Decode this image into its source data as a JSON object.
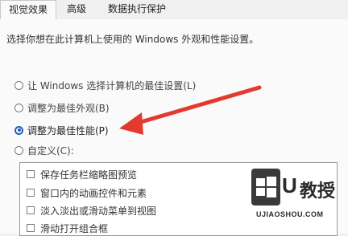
{
  "tabs": [
    {
      "label": "视觉效果",
      "active": true
    },
    {
      "label": "高级",
      "active": false
    },
    {
      "label": "数据执行保护",
      "active": false
    }
  ],
  "intro_text": "选择你想在此计算机上使用的 Windows 外观和性能设置。",
  "radio_options": [
    {
      "label": "让 Windows 选择计算机的最佳设置(L)",
      "checked": false
    },
    {
      "label": "调整为最佳外观(B)",
      "checked": false
    },
    {
      "label": "调整为最佳性能(P)",
      "checked": true
    },
    {
      "label": "自定义(C):",
      "checked": false
    }
  ],
  "checkbox_items": [
    {
      "label": "保存任务栏缩略图预览",
      "checked": false
    },
    {
      "label": "窗口内的动画控件和元素",
      "checked": false
    },
    {
      "label": "淡入淡出或滑动菜单到视图",
      "checked": false
    },
    {
      "label": "滑动打开组合框",
      "checked": false
    }
  ],
  "annotation": {
    "arrow_color": "#e23a2e"
  },
  "watermark": {
    "brand_letter": "U",
    "brand_text": "教授",
    "url": "UJIAOSHOU.COM",
    "icon": "windows-logo-icon"
  },
  "colors": {
    "accent": "#1f5fbf",
    "panel": "#fafafa",
    "chrome": "#f0f0f0"
  }
}
